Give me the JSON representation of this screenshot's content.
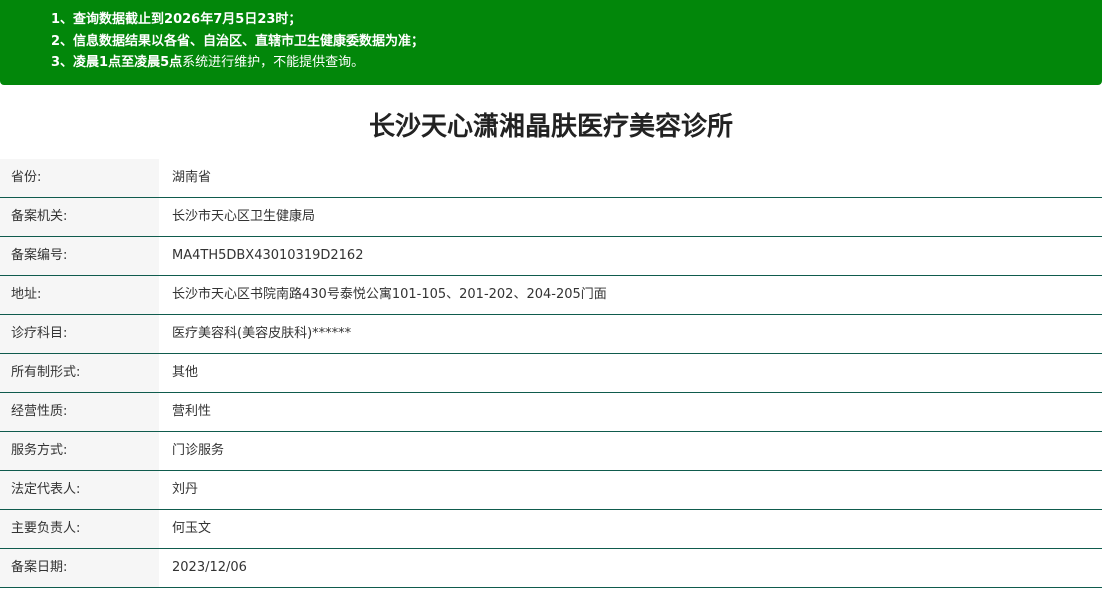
{
  "notice": {
    "line1": {
      "prefix": "1、",
      "text": "查询数据截止到2026年7月5日23时；"
    },
    "line2": {
      "prefix": "2、",
      "text": "信息数据结果以各省、自治区、直辖市卫生健康委数据为准；"
    },
    "line3": {
      "prefix": "3、",
      "bold_text": "凌晨1点至凌晨5点",
      "text": "系统进行维护，不能提供查询。"
    },
    "background_color": "#02870a"
  },
  "title": "长沙天心潇湘晶肤医疗美容诊所",
  "details": [
    {
      "label": "省份:",
      "value": "湖南省"
    },
    {
      "label": "备案机关:",
      "value": "长沙市天心区卫生健康局"
    },
    {
      "label": "备案编号:",
      "value": "MA4TH5DBX43010319D2162"
    },
    {
      "label": "地址:",
      "value": "长沙市天心区书院南路430号泰悦公寓101-105、201-202、204-205门面"
    },
    {
      "label": "诊疗科目:",
      "value": "医疗美容科(美容皮肤科)******"
    },
    {
      "label": "所有制形式:",
      "value": "其他"
    },
    {
      "label": "经营性质:",
      "value": "营利性"
    },
    {
      "label": "服务方式:",
      "value": "门诊服务"
    },
    {
      "label": "法定代表人:",
      "value": "刘丹"
    },
    {
      "label": "主要负责人:",
      "value": "何玉文"
    },
    {
      "label": "备案日期:",
      "value": "2023/12/06"
    }
  ]
}
